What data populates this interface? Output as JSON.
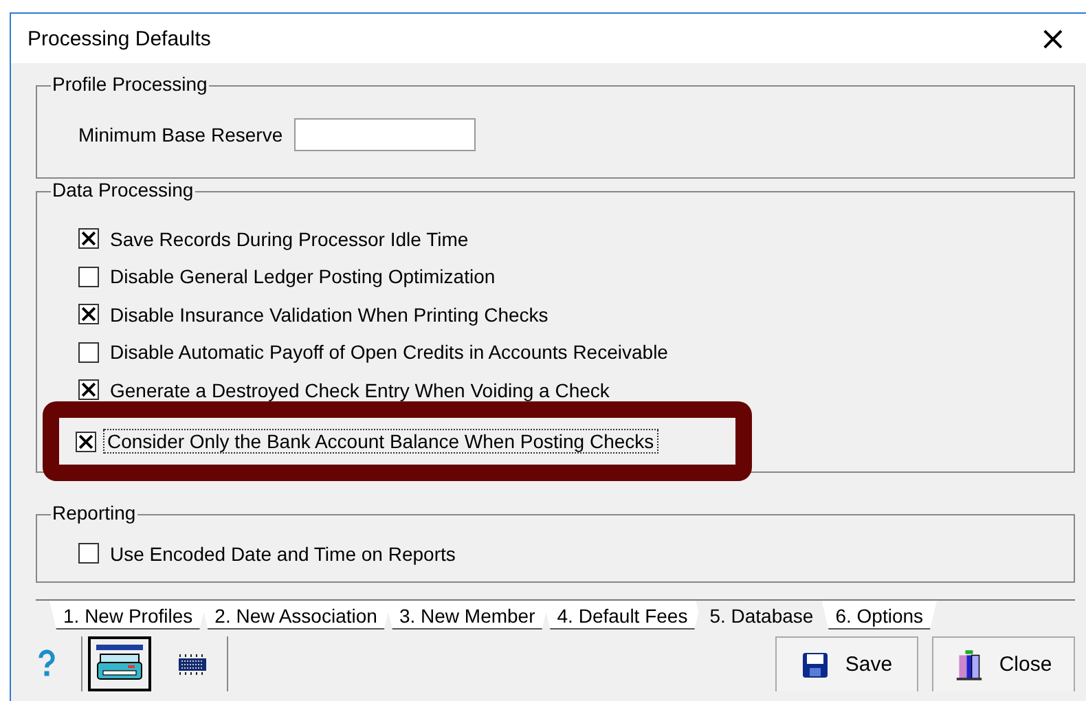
{
  "window": {
    "title": "Processing Defaults",
    "close": "×"
  },
  "profile_processing": {
    "title": "Profile Processing",
    "field_label": "Minimum Base Reserve"
  },
  "data_processing": {
    "title": "Data Processing",
    "options": [
      {
        "label": "Save Records During Processor Idle Time",
        "checked": true
      },
      {
        "label": "Disable General Ledger Posting Optimization",
        "checked": false
      },
      {
        "label": "Disable Insurance Validation When Printing Checks",
        "checked": true
      },
      {
        "label": "Disable Automatic Payoff of Open Credits in Accounts Receivable",
        "checked": false
      },
      {
        "label": "Generate a Destroyed Check Entry When Voiding a Check",
        "checked": true
      }
    ],
    "highlighted_option": {
      "label": "Consider Only the Bank Account Balance When Posting Checks",
      "checked": true
    }
  },
  "reporting": {
    "title": "Reporting",
    "options": [
      {
        "label": "Use Encoded Date and Time on Reports",
        "checked": false
      }
    ]
  },
  "tabs": [
    {
      "label": "1. New Profiles",
      "selected": false
    },
    {
      "label": "2. New Association",
      "selected": false
    },
    {
      "label": "3. New Member",
      "selected": false
    },
    {
      "label": "4. Default Fees",
      "selected": false
    },
    {
      "label": "5. Database",
      "selected": true
    },
    {
      "label": "6. Options",
      "selected": false
    }
  ],
  "buttons": [
    {
      "label": "Save",
      "kind": "save"
    },
    {
      "label": "Close",
      "kind": "close"
    }
  ]
}
